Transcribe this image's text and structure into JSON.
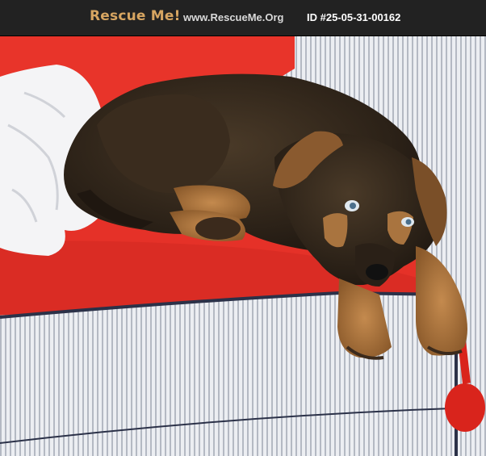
{
  "header": {
    "brand": "Rescue Me!",
    "site": "www.RescueMe.Org",
    "pet_id": "ID #25-05-31-00162"
  },
  "photo": {
    "subject": "dog-photo",
    "colors": {
      "blanket": "#e8342a",
      "cushion": "#eceef2",
      "stripe": "#b4b9c3",
      "piping": "#2b3148",
      "dog_dark": "#2a2017",
      "dog_tan": "#a9743f"
    }
  }
}
